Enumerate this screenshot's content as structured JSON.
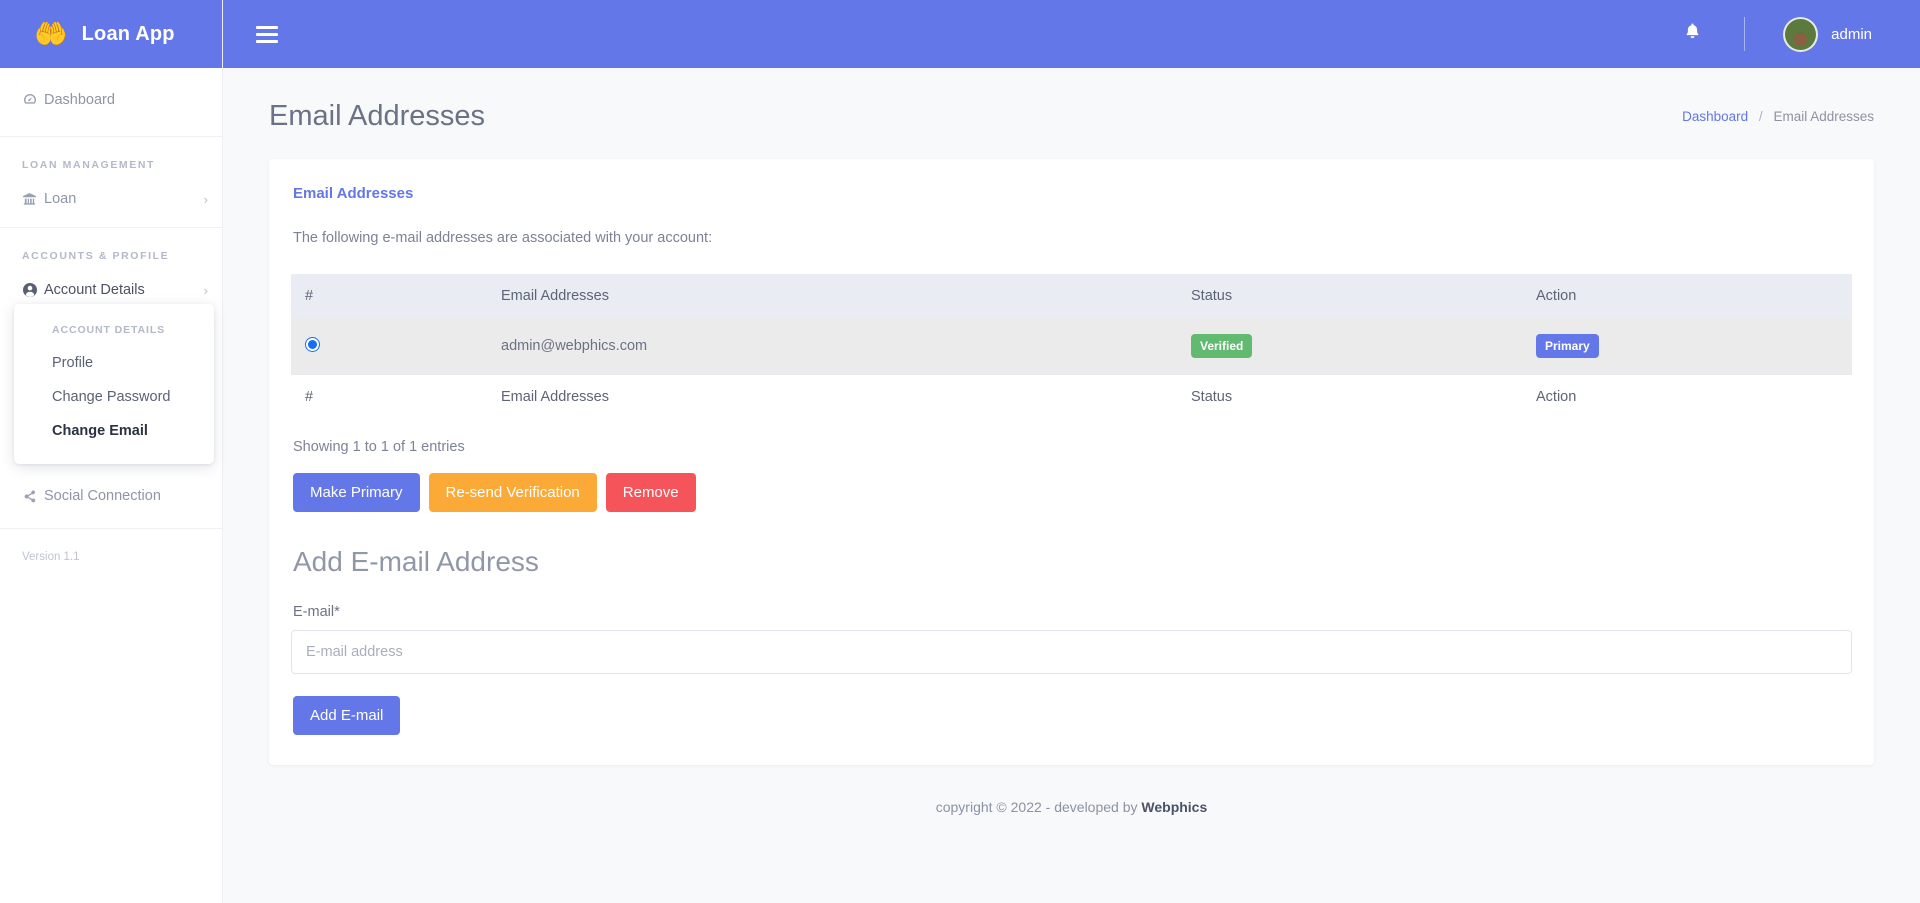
{
  "brand": {
    "logo_icon": "money-hands-icon",
    "name": "Loan App"
  },
  "topbar": {
    "menu_icon": "hamburger-menu-icon",
    "bell_icon": "notification-bell-icon",
    "avatar_icon": "user-avatar",
    "username": "admin"
  },
  "sidebar": {
    "dashboard": {
      "label": "Dashboard",
      "icon": "dashboard-gauge-icon"
    },
    "sections": [
      {
        "heading": "LOAN MANAGEMENT",
        "items": [
          {
            "label": "Loan",
            "icon": "bank-icon",
            "chevron": "›"
          }
        ]
      },
      {
        "heading": "ACCOUNTS & PROFILE",
        "items": [
          {
            "label": "Account Details",
            "icon": "user-circle-icon",
            "chevron": "›"
          }
        ]
      }
    ],
    "social": {
      "label": "Social Connection",
      "icon": "share-nodes-icon"
    },
    "version": "Version 1.1",
    "submenu": {
      "heading": "ACCOUNT DETAILS",
      "items": [
        {
          "label": "Profile",
          "active": false
        },
        {
          "label": "Change Password",
          "active": false
        },
        {
          "label": "Change Email",
          "active": true
        }
      ]
    }
  },
  "page": {
    "title": "Email Addresses",
    "breadcrumb": {
      "root": "Dashboard",
      "separator": "/",
      "current": "Email Addresses"
    }
  },
  "card": {
    "title": "Email Addresses",
    "description": "The following e-mail addresses are associated with your account:",
    "table": {
      "columns": [
        "#",
        "Email Addresses",
        "Status",
        "Action"
      ],
      "rows": [
        {
          "selected": true,
          "email": "admin@webphics.com",
          "status": "Verified",
          "action": "Primary"
        }
      ],
      "footer_columns": [
        "#",
        "Email Addresses",
        "Status",
        "Action"
      ]
    },
    "showing": "Showing 1 to 1 of 1 entries",
    "buttons": [
      {
        "label": "Make Primary",
        "style": "blue"
      },
      {
        "label": "Re-send Verification",
        "style": "orange"
      },
      {
        "label": "Remove",
        "style": "red"
      }
    ],
    "add_section": {
      "title": "Add E-mail Address",
      "field_label": "E-mail*",
      "input_placeholder": "E-mail address",
      "input_value": "",
      "submit_label": "Add E-mail"
    }
  },
  "footer": {
    "text": "copyright © 2022 - developed by ",
    "brand": "Webphics"
  },
  "colors": {
    "accent": "#6377e8",
    "verified": "#61ba6f",
    "warning": "#fba937",
    "danger": "#f5545a"
  }
}
